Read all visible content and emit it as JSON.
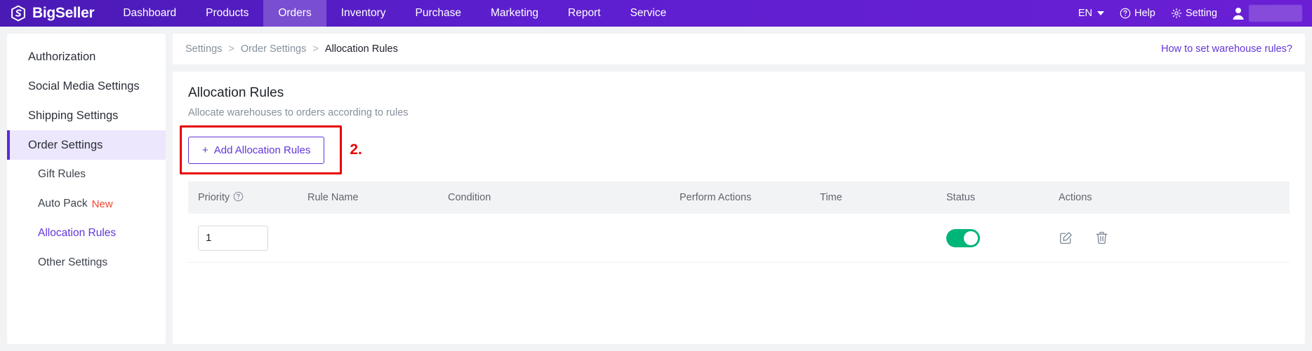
{
  "app": {
    "brand": "BigSeller",
    "brand_logo_icon": "bigseller-logo-icon"
  },
  "topnav": {
    "items": [
      {
        "label": "Dashboard",
        "active": false
      },
      {
        "label": "Products",
        "active": false
      },
      {
        "label": "Orders",
        "active": true
      },
      {
        "label": "Inventory",
        "active": false
      },
      {
        "label": "Purchase",
        "active": false
      },
      {
        "label": "Marketing",
        "active": false
      },
      {
        "label": "Report",
        "active": false
      },
      {
        "label": "Service",
        "active": false
      }
    ],
    "language": "EN",
    "help": "Help",
    "setting": "Setting",
    "icons": {
      "language_caret": "chevron-down-icon",
      "help": "question-circle-icon",
      "setting": "gear-icon",
      "avatar": "user-avatar-icon"
    }
  },
  "sidebar": {
    "items": [
      {
        "label": "Authorization",
        "active": false
      },
      {
        "label": "Social Media Settings",
        "active": false
      },
      {
        "label": "Shipping Settings",
        "active": false
      },
      {
        "label": "Order Settings",
        "active": true
      }
    ],
    "sub_items": [
      {
        "label": "Gift Rules",
        "badge": "",
        "current": false
      },
      {
        "label": "Auto Pack",
        "badge": "New",
        "current": false
      },
      {
        "label": "Allocation Rules",
        "badge": "",
        "current": true
      },
      {
        "label": "Other Settings",
        "badge": "",
        "current": false
      }
    ]
  },
  "breadcrumb": {
    "items": [
      "Settings",
      "Order Settings",
      "Allocation Rules"
    ],
    "separator": ">",
    "help_link": "How to set warehouse rules?"
  },
  "card": {
    "title": "Allocation Rules",
    "subtitle": "Allocate warehouses to orders according to rules",
    "add_button": "Add Allocation Rules",
    "add_button_plus": "+",
    "annotation_number": "2."
  },
  "table": {
    "columns": [
      "Priority",
      "Rule Name",
      "Condition",
      "Perform Actions",
      "Time",
      "Status",
      "Actions"
    ],
    "priority_help_icon": "question-circle-icon",
    "rows": [
      {
        "priority": "1",
        "rule_name": "",
        "condition": "",
        "perform_actions": "",
        "time": "",
        "status_on": true,
        "edit_icon": "edit-pencil-icon",
        "delete_icon": "trash-icon"
      }
    ]
  },
  "colors": {
    "brand_purple": "#5a19c4",
    "accent_purple": "#6236d9",
    "toggle_green": "#00b578",
    "annotation_red": "#e60000",
    "badge_red": "#f4452f"
  }
}
